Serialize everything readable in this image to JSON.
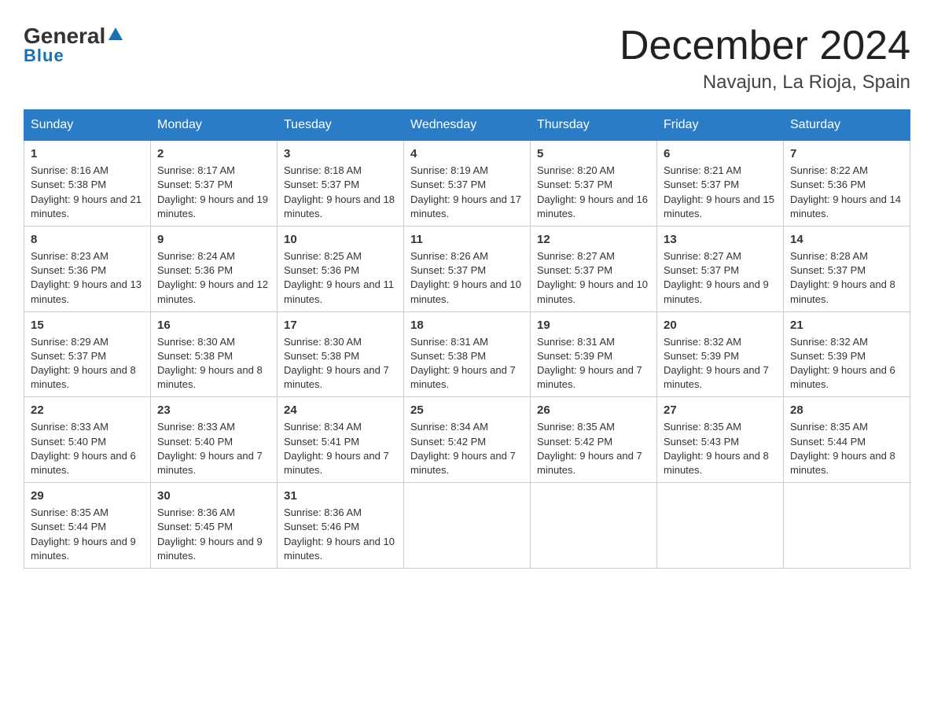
{
  "logo": {
    "general": "General",
    "blue": "Blue"
  },
  "title": "December 2024",
  "location": "Navajun, La Rioja, Spain",
  "days_header": [
    "Sunday",
    "Monday",
    "Tuesday",
    "Wednesday",
    "Thursday",
    "Friday",
    "Saturday"
  ],
  "weeks": [
    [
      {
        "day": "1",
        "sunrise": "8:16 AM",
        "sunset": "5:38 PM",
        "daylight": "9 hours and 21 minutes."
      },
      {
        "day": "2",
        "sunrise": "8:17 AM",
        "sunset": "5:37 PM",
        "daylight": "9 hours and 19 minutes."
      },
      {
        "day": "3",
        "sunrise": "8:18 AM",
        "sunset": "5:37 PM",
        "daylight": "9 hours and 18 minutes."
      },
      {
        "day": "4",
        "sunrise": "8:19 AM",
        "sunset": "5:37 PM",
        "daylight": "9 hours and 17 minutes."
      },
      {
        "day": "5",
        "sunrise": "8:20 AM",
        "sunset": "5:37 PM",
        "daylight": "9 hours and 16 minutes."
      },
      {
        "day": "6",
        "sunrise": "8:21 AM",
        "sunset": "5:37 PM",
        "daylight": "9 hours and 15 minutes."
      },
      {
        "day": "7",
        "sunrise": "8:22 AM",
        "sunset": "5:36 PM",
        "daylight": "9 hours and 14 minutes."
      }
    ],
    [
      {
        "day": "8",
        "sunrise": "8:23 AM",
        "sunset": "5:36 PM",
        "daylight": "9 hours and 13 minutes."
      },
      {
        "day": "9",
        "sunrise": "8:24 AM",
        "sunset": "5:36 PM",
        "daylight": "9 hours and 12 minutes."
      },
      {
        "day": "10",
        "sunrise": "8:25 AM",
        "sunset": "5:36 PM",
        "daylight": "9 hours and 11 minutes."
      },
      {
        "day": "11",
        "sunrise": "8:26 AM",
        "sunset": "5:37 PM",
        "daylight": "9 hours and 10 minutes."
      },
      {
        "day": "12",
        "sunrise": "8:27 AM",
        "sunset": "5:37 PM",
        "daylight": "9 hours and 10 minutes."
      },
      {
        "day": "13",
        "sunrise": "8:27 AM",
        "sunset": "5:37 PM",
        "daylight": "9 hours and 9 minutes."
      },
      {
        "day": "14",
        "sunrise": "8:28 AM",
        "sunset": "5:37 PM",
        "daylight": "9 hours and 8 minutes."
      }
    ],
    [
      {
        "day": "15",
        "sunrise": "8:29 AM",
        "sunset": "5:37 PM",
        "daylight": "9 hours and 8 minutes."
      },
      {
        "day": "16",
        "sunrise": "8:30 AM",
        "sunset": "5:38 PM",
        "daylight": "9 hours and 8 minutes."
      },
      {
        "day": "17",
        "sunrise": "8:30 AM",
        "sunset": "5:38 PM",
        "daylight": "9 hours and 7 minutes."
      },
      {
        "day": "18",
        "sunrise": "8:31 AM",
        "sunset": "5:38 PM",
        "daylight": "9 hours and 7 minutes."
      },
      {
        "day": "19",
        "sunrise": "8:31 AM",
        "sunset": "5:39 PM",
        "daylight": "9 hours and 7 minutes."
      },
      {
        "day": "20",
        "sunrise": "8:32 AM",
        "sunset": "5:39 PM",
        "daylight": "9 hours and 7 minutes."
      },
      {
        "day": "21",
        "sunrise": "8:32 AM",
        "sunset": "5:39 PM",
        "daylight": "9 hours and 6 minutes."
      }
    ],
    [
      {
        "day": "22",
        "sunrise": "8:33 AM",
        "sunset": "5:40 PM",
        "daylight": "9 hours and 6 minutes."
      },
      {
        "day": "23",
        "sunrise": "8:33 AM",
        "sunset": "5:40 PM",
        "daylight": "9 hours and 7 minutes."
      },
      {
        "day": "24",
        "sunrise": "8:34 AM",
        "sunset": "5:41 PM",
        "daylight": "9 hours and 7 minutes."
      },
      {
        "day": "25",
        "sunrise": "8:34 AM",
        "sunset": "5:42 PM",
        "daylight": "9 hours and 7 minutes."
      },
      {
        "day": "26",
        "sunrise": "8:35 AM",
        "sunset": "5:42 PM",
        "daylight": "9 hours and 7 minutes."
      },
      {
        "day": "27",
        "sunrise": "8:35 AM",
        "sunset": "5:43 PM",
        "daylight": "9 hours and 8 minutes."
      },
      {
        "day": "28",
        "sunrise": "8:35 AM",
        "sunset": "5:44 PM",
        "daylight": "9 hours and 8 minutes."
      }
    ],
    [
      {
        "day": "29",
        "sunrise": "8:35 AM",
        "sunset": "5:44 PM",
        "daylight": "9 hours and 9 minutes."
      },
      {
        "day": "30",
        "sunrise": "8:36 AM",
        "sunset": "5:45 PM",
        "daylight": "9 hours and 9 minutes."
      },
      {
        "day": "31",
        "sunrise": "8:36 AM",
        "sunset": "5:46 PM",
        "daylight": "9 hours and 10 minutes."
      },
      null,
      null,
      null,
      null
    ]
  ],
  "labels": {
    "sunrise": "Sunrise:",
    "sunset": "Sunset:",
    "daylight": "Daylight:"
  }
}
